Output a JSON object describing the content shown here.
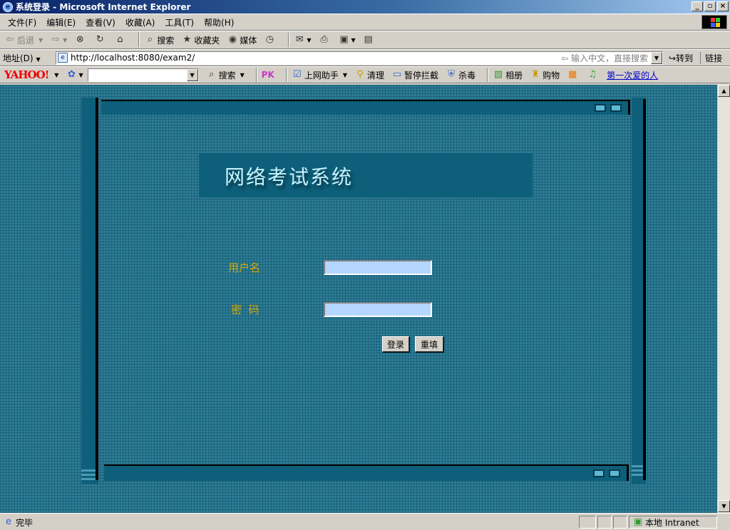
{
  "window": {
    "title": "系统登录 - Microsoft Internet Explorer",
    "controls": {
      "minimize": "_",
      "maximize": "▫",
      "close": "×"
    }
  },
  "menubar": {
    "items": [
      "文件(F)",
      "编辑(E)",
      "查看(V)",
      "收藏(A)",
      "工具(T)",
      "帮助(H)"
    ]
  },
  "toolbar": {
    "back": "后退",
    "search": "搜索",
    "favorites": "收藏夹",
    "media": "媒体"
  },
  "addressbar": {
    "label": "地址(D)",
    "url": "http://localhost:8080/exam2/",
    "hint": "输入中文，直接搜索",
    "go": "转到",
    "links": "链接"
  },
  "yahoobar": {
    "logo": "YAHOO!",
    "search": "搜索",
    "pk": "PK",
    "helper": "上网助手",
    "clean": "清理",
    "block": "暂停拦截",
    "antivirus": "杀毒",
    "album": "相册",
    "shopping": "购物",
    "link_text": "第一次爱的人"
  },
  "page": {
    "system_title": "网络考试系统",
    "username_label": "用户名",
    "password_label": "密  码",
    "username_value": "",
    "password_value": "",
    "login_button": "登录",
    "reset_button": "重填"
  },
  "statusbar": {
    "status": "完毕",
    "zone": "本地 Intranet"
  },
  "colors": {
    "page_bg": "#2c7d96",
    "frame_dark": "#0d5f7a",
    "label_gold": "#d4a800",
    "title_cyan": "#c6f4ff",
    "input_bg": "#b4d6ff"
  }
}
